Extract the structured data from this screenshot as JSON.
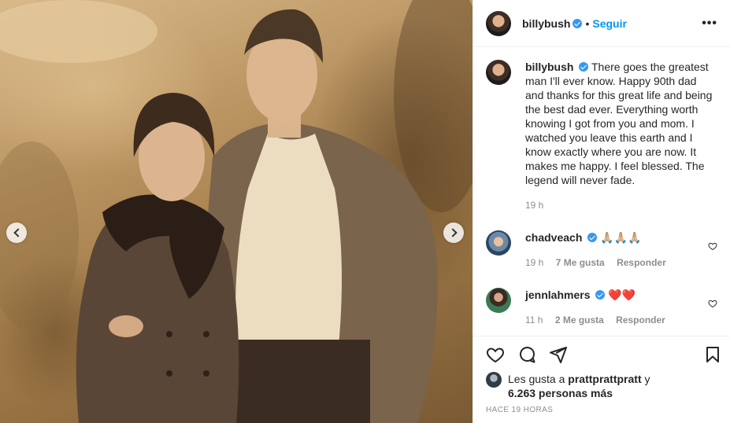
{
  "post": {
    "username": "billybush",
    "follow_label": "Seguir",
    "more_label": "•••",
    "caption": "There goes the greatest man I'll ever know. Happy 90th dad and thanks for this great life and being the best dad ever. Everything worth knowing I got from you and mom. I watched you leave this earth and I know exactly where you are now. It makes me happy. I feel blessed. The legend will never fade.",
    "caption_time": "19 h",
    "icons": [
      "heart-icon",
      "comment-icon",
      "share-icon",
      "bookmark-icon",
      "chevron-left-icon",
      "chevron-right-icon",
      "verified-icon"
    ],
    "accent": "#0095f6"
  },
  "comments": [
    {
      "username": "chadveach",
      "text": "🙏🏼🙏🏼🙏🏼",
      "time": "19 h",
      "likes": "7 Me gusta",
      "reply": "Responder"
    },
    {
      "username": "jennlahmers",
      "text": "❤️❤️",
      "time": "11 h",
      "likes": "2 Me gusta",
      "reply": "Responder"
    }
  ],
  "likes": {
    "prefix": "Les gusta a",
    "user": "prattprattpratt",
    "join": "y",
    "others": "6.263 personas más"
  },
  "timestamp": "Hace 19 horas"
}
